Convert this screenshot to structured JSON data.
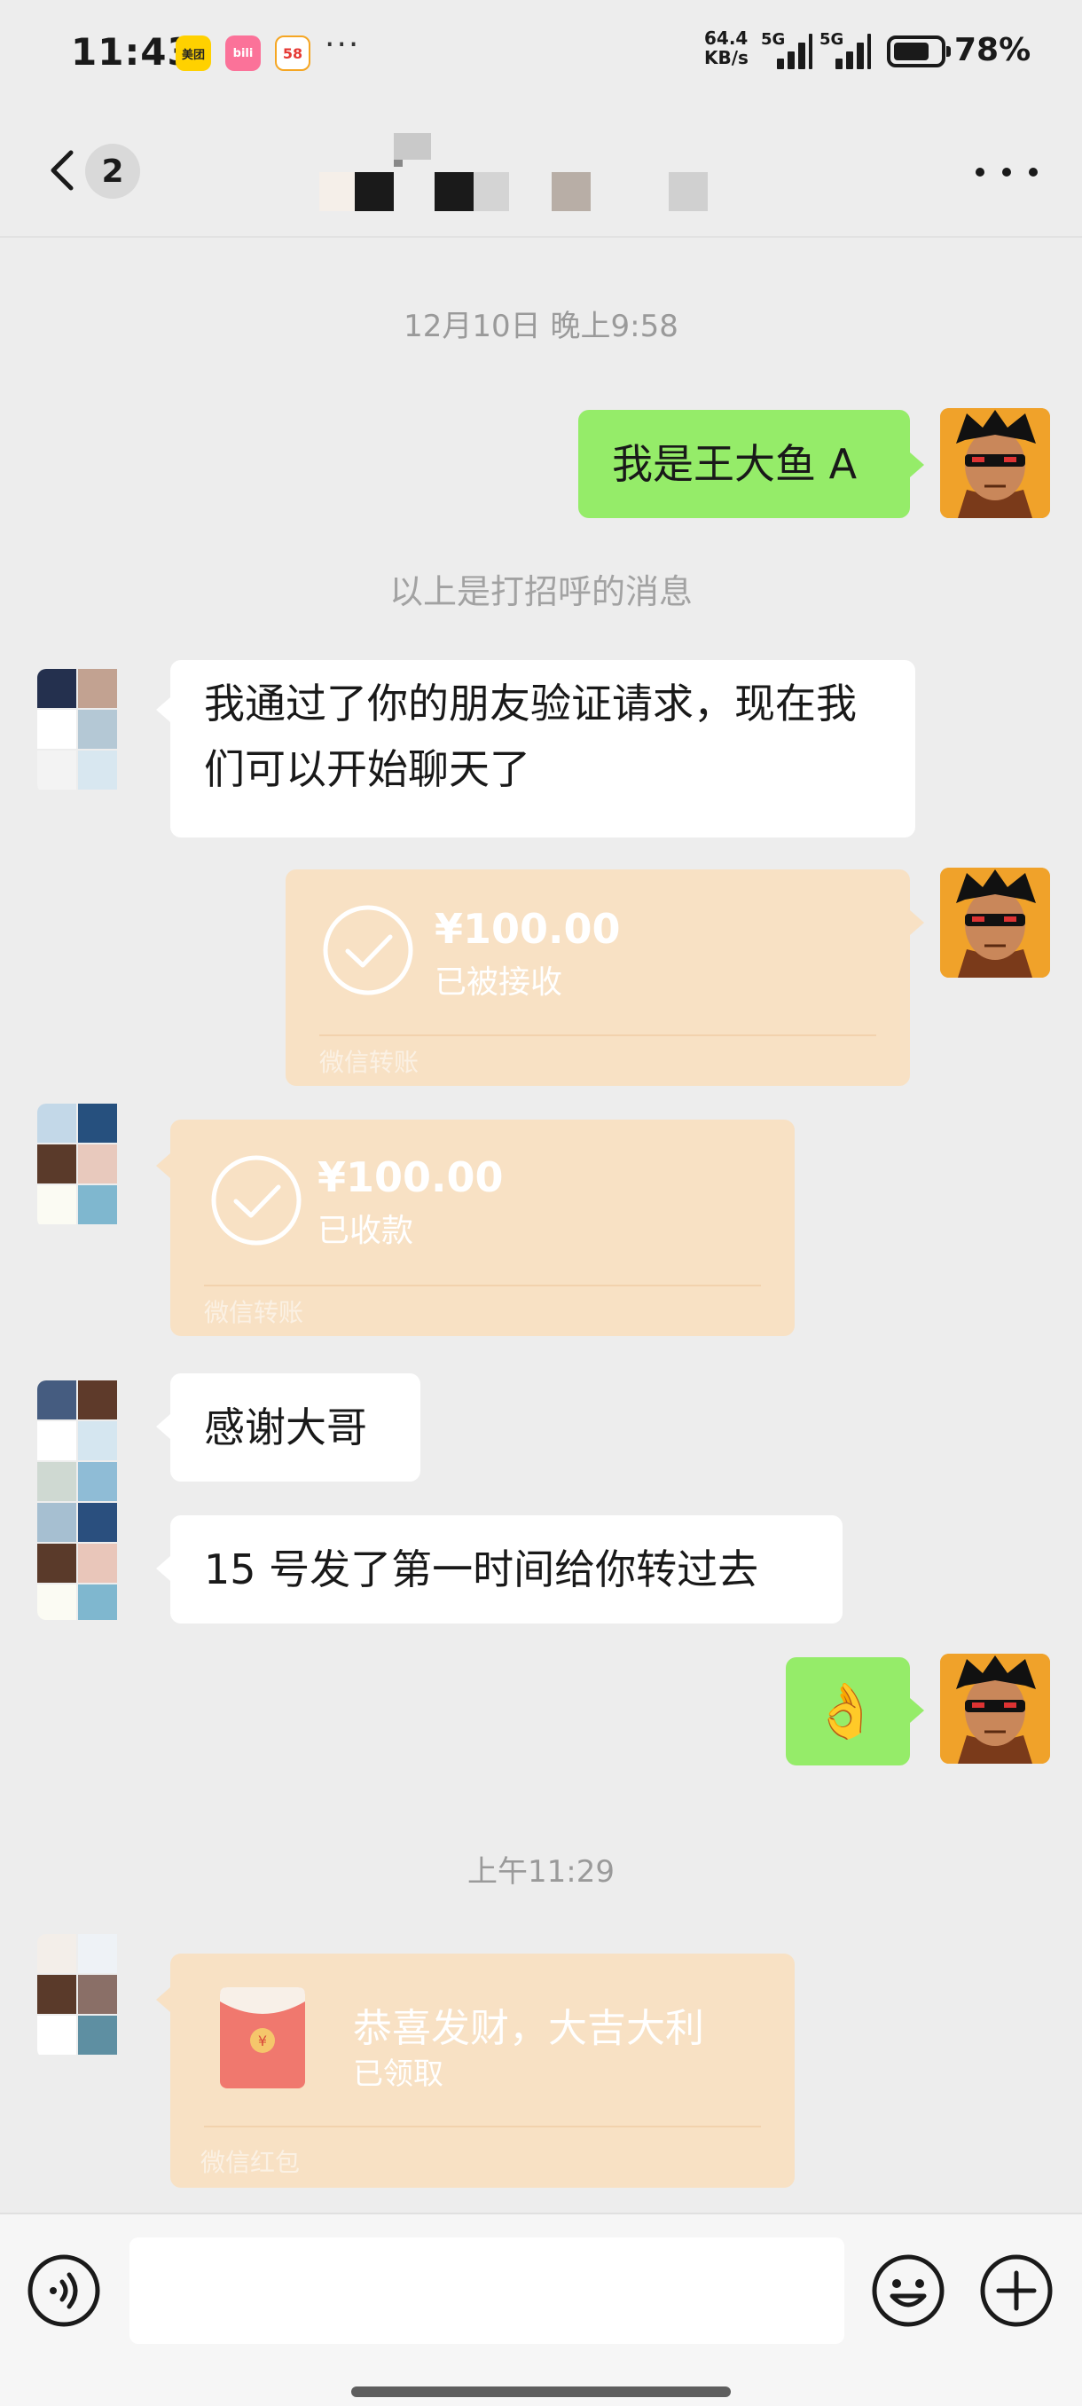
{
  "status_bar": {
    "time": "11:43",
    "app_icons": [
      {
        "name": "meituan",
        "label": "美团",
        "color": "#ffd100"
      },
      {
        "name": "bilibili",
        "label": "bili",
        "color": "#fb7299"
      },
      {
        "name": "58",
        "label": "58",
        "color": "#e53935"
      }
    ],
    "more_indicator": "···",
    "net_speed_value": "64.4",
    "net_speed_unit": "KB/s",
    "signal1_label": "5G",
    "signal2_label": "5G",
    "battery_percent": "78%",
    "battery_level": 0.78
  },
  "nav": {
    "back_icon": "chevron-left-icon",
    "unread_count": "2",
    "more_icon": "more-dots-icon"
  },
  "chat": {
    "timestamp_1": "12月10日 晚上9:58",
    "msg_me_1": "我是王大鱼 A",
    "system_notice": "以上是打招呼的消息",
    "msg_them_1": "我通过了你的朋友验证请求，现在我们可以开始聊天了",
    "transfer_sent": {
      "amount": "¥100.00",
      "status": "已被接收",
      "footer": "微信转账"
    },
    "transfer_received": {
      "amount": "¥100.00",
      "status": "已收款",
      "footer": "微信转账"
    },
    "msg_them_2": "感谢大哥",
    "msg_them_3": "15 号发了第一时间给你转过去",
    "msg_me_2": "👌",
    "timestamp_2": "上午11:29",
    "red_packet": {
      "greeting": "恭喜发财，大吉大利",
      "status": "已领取",
      "footer": "微信红包"
    }
  },
  "input_bar": {
    "voice_icon": "voice-icon",
    "message_value": "",
    "emoji_icon": "emoji-icon",
    "plus_icon": "plus-icon"
  },
  "colors": {
    "background": "#ededed",
    "bubble_me": "#95ec69",
    "bubble_them": "#ffffff",
    "transfer_card": "#f8e1c4"
  }
}
